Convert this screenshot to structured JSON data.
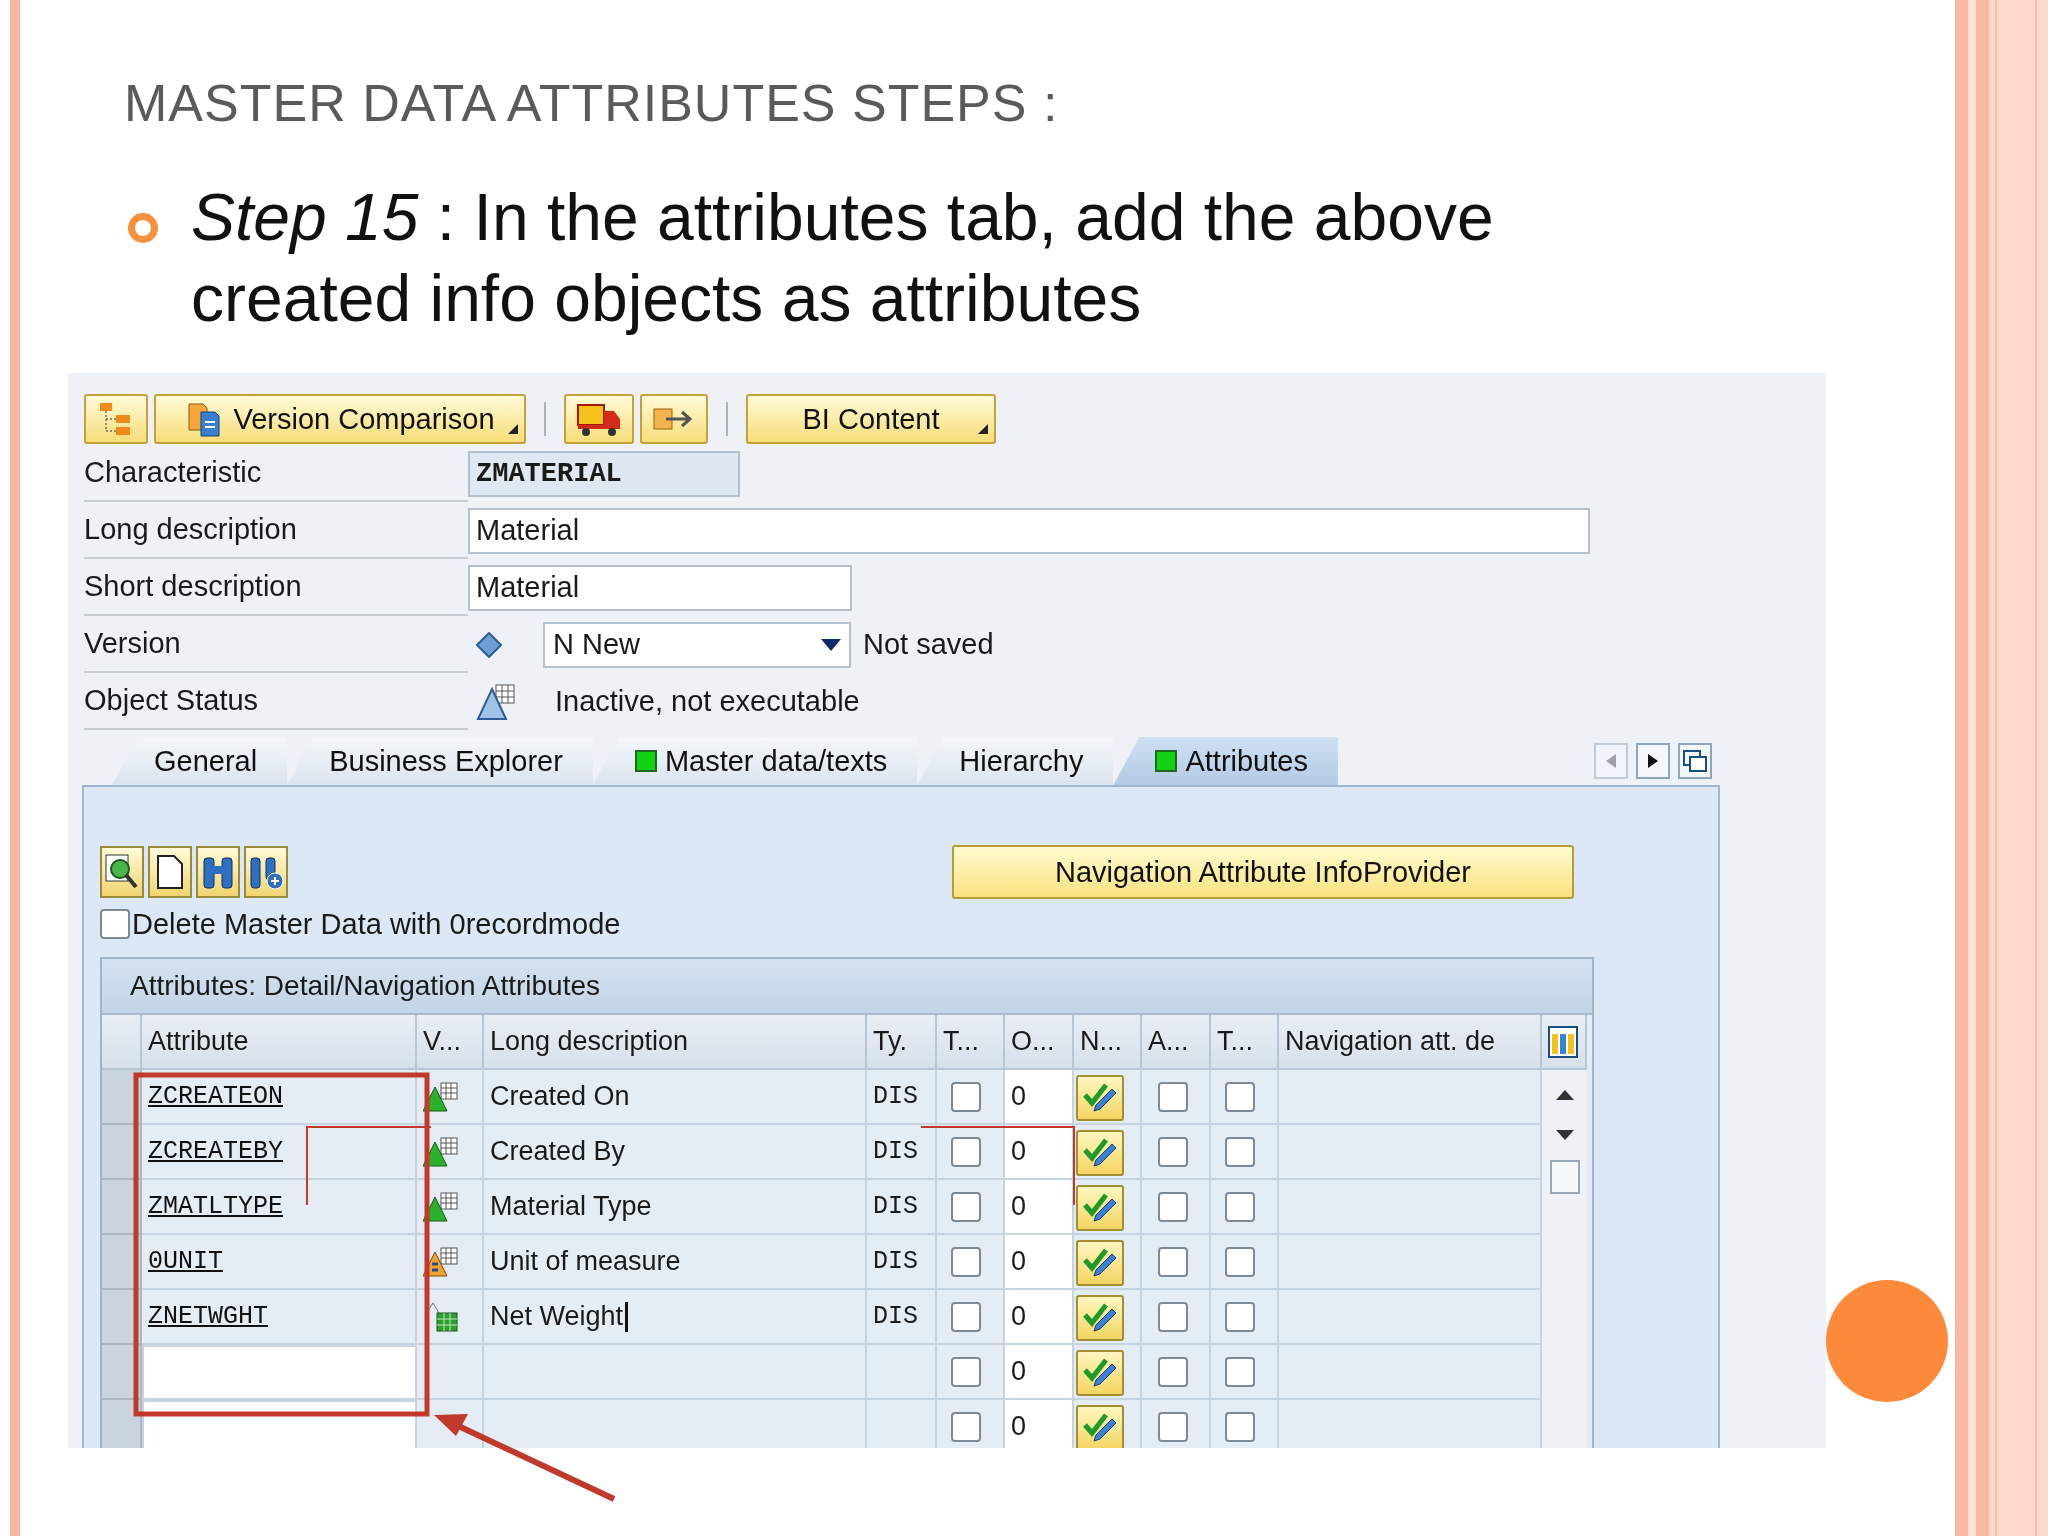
{
  "slide": {
    "title": "MASTER DATA ATTRIBUTES STEPS :",
    "bullet": "*Step 15* : In the attributes tab, add the above created info objects as attributes"
  },
  "toolbar": [
    {
      "kind": "icon"
    },
    {
      "kind": "menu",
      "label": "Version Comparison"
    },
    {
      "kind": "separator"
    },
    {
      "kind": "icon"
    },
    {
      "kind": "icon"
    },
    {
      "kind": "separator"
    },
    {
      "kind": "menu",
      "label": "BI Content"
    }
  ],
  "form": {
    "characteristic": {
      "label": "Characteristic",
      "value": "ZMATERIAL"
    },
    "long_description": {
      "label": "Long description",
      "value": "Material"
    },
    "short_description": {
      "label": "Short description",
      "value": "Material"
    },
    "version": {
      "label": "Version",
      "value": "N New",
      "status": "Not saved"
    },
    "object_status": {
      "label": "Object Status",
      "value": "Inactive, not executable"
    }
  },
  "tabs": [
    {
      "label": "General",
      "selected": false,
      "status_ok": false
    },
    {
      "label": "Business Explorer",
      "selected": false,
      "status_ok": false
    },
    {
      "label": "Master data/texts",
      "selected": false,
      "status_ok": true
    },
    {
      "label": "Hierarchy",
      "selected": false,
      "status_ok": false
    },
    {
      "label": "Attributes",
      "selected": true,
      "status_ok": true
    }
  ],
  "panel": {
    "nav_button": "Navigation Attribute InfoProvider",
    "delete_option": {
      "label": "Delete Master Data with 0recordmode",
      "checked": false
    }
  },
  "table": {
    "title": "Attributes: Detail/Navigation Attributes",
    "columns": [
      "Attribute",
      "V...",
      "Long description",
      "Ty.",
      "T...",
      "O...",
      "N...",
      "A...",
      "T...",
      "Navigation att. de"
    ],
    "rows": [
      {
        "kind": "characteristic",
        "attribute": "ZCREATEON",
        "long_description": "Created On",
        "type": "DIS",
        "t1_checked": false,
        "o": "0",
        "a_checked": false,
        "t2_checked": false,
        "text_cursor": false
      },
      {
        "kind": "characteristic",
        "attribute": "ZCREATEBY",
        "long_description": "Created By",
        "type": "DIS",
        "t1_checked": false,
        "o": "0",
        "a_checked": false,
        "t2_checked": false,
        "text_cursor": false
      },
      {
        "kind": "characteristic",
        "attribute": "ZMATLTYPE",
        "long_description": "Material Type",
        "type": "DIS",
        "t1_checked": false,
        "o": "0",
        "a_checked": false,
        "t2_checked": false,
        "text_cursor": false
      },
      {
        "kind": "unit",
        "attribute": "0UNIT",
        "long_description": "Unit of measure",
        "type": "DIS",
        "t1_checked": false,
        "o": "0",
        "a_checked": false,
        "t2_checked": false,
        "text_cursor": false
      },
      {
        "kind": "key_figure",
        "attribute": "ZNETWGHT",
        "long_description": "Net Weight",
        "type": "DIS",
        "t1_checked": false,
        "o": "0",
        "a_checked": false,
        "t2_checked": false,
        "text_cursor": true
      },
      {
        "kind": "empty",
        "t1_checked": false,
        "o": "0",
        "a_checked": false,
        "t2_checked": false,
        "text_cursor": false
      },
      {
        "kind": "empty",
        "t1_checked": false,
        "o": "0",
        "a_checked": false,
        "t2_checked": false,
        "text_cursor": false
      }
    ]
  }
}
